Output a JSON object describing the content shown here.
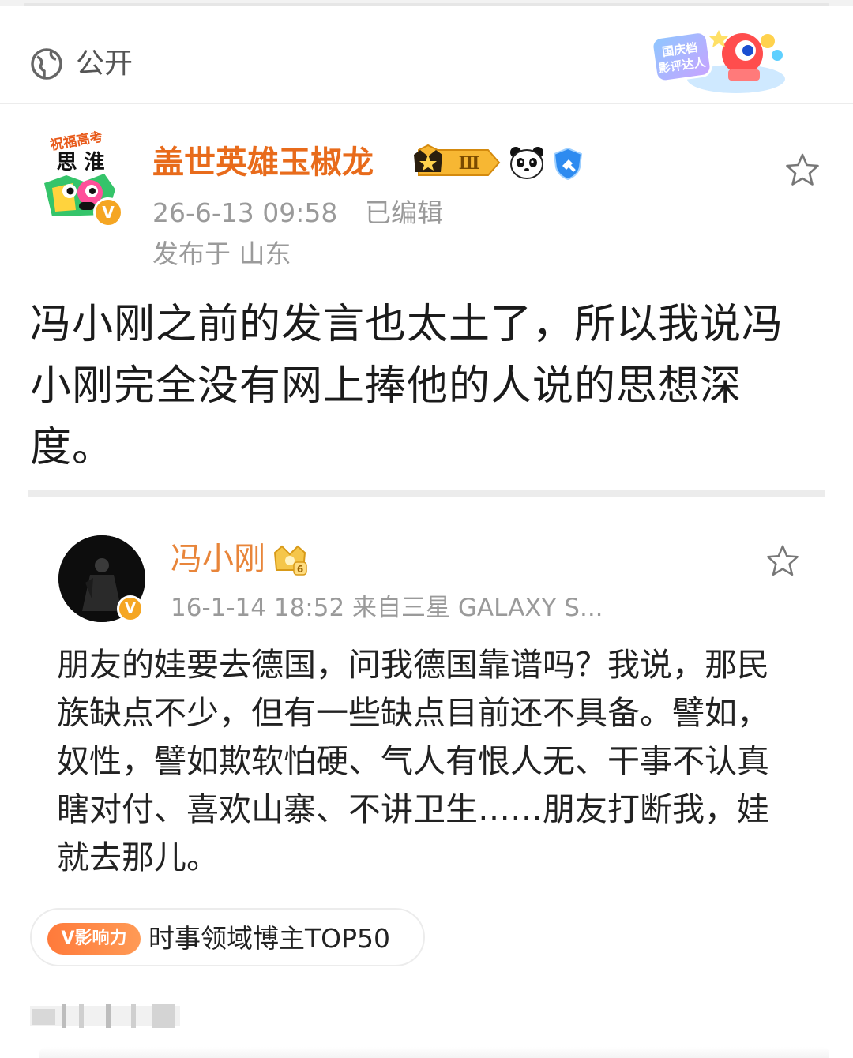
{
  "visibility": {
    "label": "公开",
    "icon": "globe-icon"
  },
  "event_badge": {
    "text_line1": "国庆档",
    "text_line2": "影评达人"
  },
  "post": {
    "author": "盖世英雄玉椒龙",
    "vip_level": "Ⅲ",
    "time": "26-6-13 09:58",
    "edited": "已编辑",
    "location": "发布于 山东",
    "avatar_caption_top": "祝福高考",
    "avatar_caption_mid": "思 淮",
    "text": "冯小刚之前的发言也太土了，所以我说冯小刚完全没有网上捧他的人说的思想深度。"
  },
  "quoted": {
    "author": "冯小刚",
    "crown_level": "6",
    "time": "16-1-14 18:52",
    "source": "来自三星 GALAXY S...",
    "text": "朋友的娃要去德国，问我德国靠谱吗？我说，那民族缺点不少，但有一些缺点目前还不具备。譬如，奴性，譬如欺软怕硬、气人有恨人无、干事不认真瞎对付、喜欢山寨、不讲卫生……朋友打断我，娃就去那儿。"
  },
  "influence": {
    "pill": "V影响力",
    "text": "时事领域博主TOP50"
  },
  "colors": {
    "author": "#e86b1b",
    "quoted_author": "#e8853a",
    "accent": "#ff7a3b",
    "meta": "#9a9a9a"
  }
}
